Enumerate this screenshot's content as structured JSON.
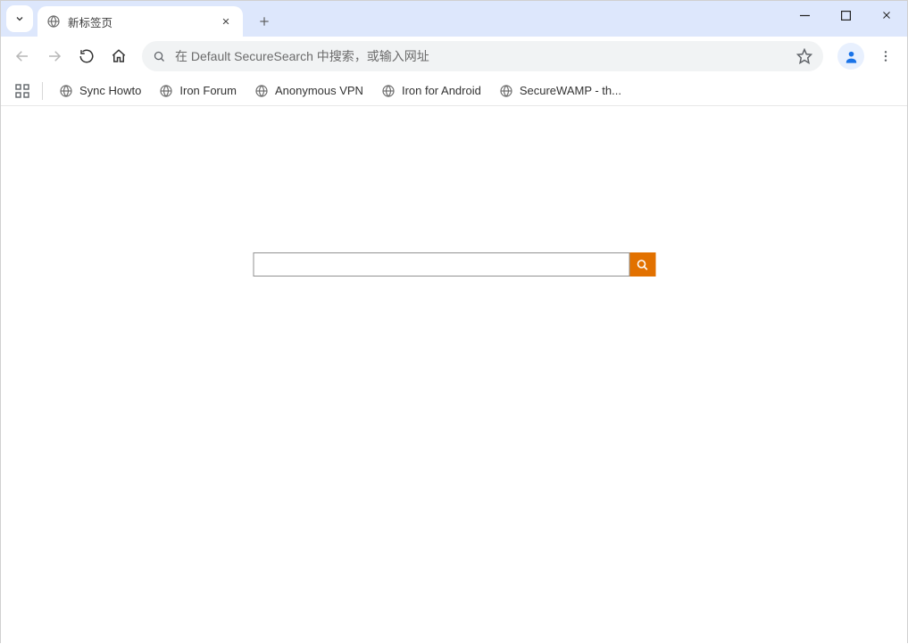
{
  "tab": {
    "title": "新标签页"
  },
  "omnibox": {
    "placeholder": "在 Default SecureSearch 中搜索，或输入网址"
  },
  "bookmarks": [
    {
      "label": "Sync Howto"
    },
    {
      "label": "Iron Forum"
    },
    {
      "label": "Anonymous VPN"
    },
    {
      "label": "Iron for Android"
    },
    {
      "label": "SecureWAMP - th..."
    }
  ],
  "search": {
    "value": ""
  }
}
